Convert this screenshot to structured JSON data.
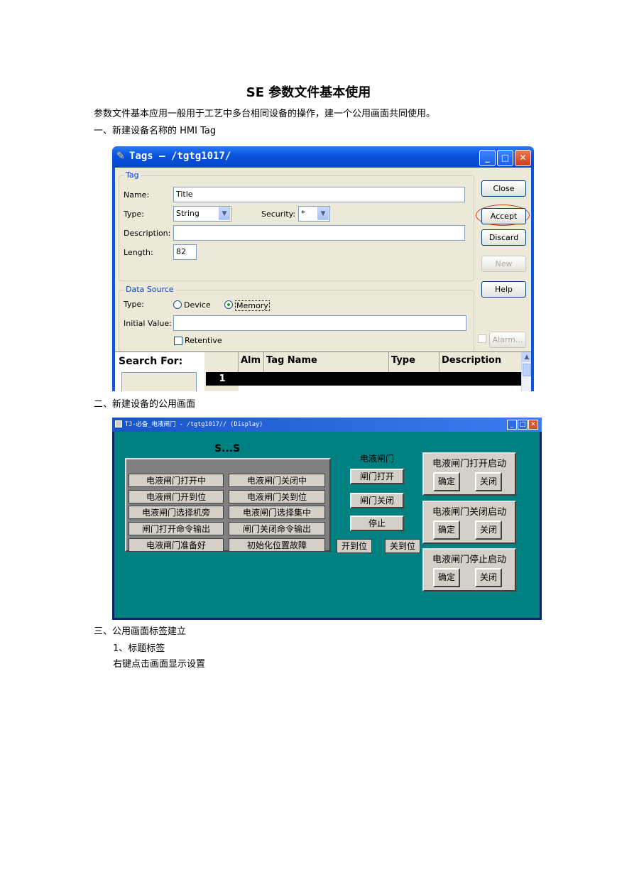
{
  "doc": {
    "title": "SE 参数文件基本使用",
    "intro": "参数文件基本应用一般用于工艺中多台相同设备的操作，建一个公用画面共同使用。",
    "step1": "一、新建设备名称的 HMI Tag",
    "step2": "二、新建设备的公用画面",
    "step3": "三、公用画面标签建立",
    "step3_1": "1、标题标签",
    "step3_2": "右键点击画面显示设置"
  },
  "tags_window": {
    "title": "Tags – /tgtg1017/",
    "group_tag": "Tag",
    "name_label": "Name:",
    "name_value": "Title",
    "type_label": "Type:",
    "type_value": "String",
    "security_label": "Security:",
    "security_value": "*",
    "description_label": "Description:",
    "description_value": "",
    "length_label": "Length:",
    "length_value": "82",
    "group_source": "Data Source",
    "source_type_label": "Type:",
    "radio_device": "Device",
    "radio_memory": "Memory",
    "initial_label": "Initial Value:",
    "initial_value": "",
    "retentive_label": "Retentive",
    "buttons": {
      "close": "Close",
      "accept": "Accept",
      "discard": "Discard",
      "new": "New",
      "help": "Help",
      "alarm": "Alarm..."
    },
    "search_label": "Search For:",
    "grid_headers": [
      "Alm",
      "Tag Name",
      "Type",
      "Description"
    ],
    "row_number": "1"
  },
  "display_window": {
    "title": "TJ-必备_电液闸门 - /tgtg1017// (Display)",
    "header_text": "S...S",
    "status_cells": [
      "电液闸门打开中",
      "电液闸门关闭中",
      "电液闸门开到位",
      "电液闸门关到位",
      "电液闸门选择机旁",
      "电液闸门选择集中",
      "闸门打开命令输出",
      "闸门关闭命令输出",
      "电液闸门准备好",
      "初始化位置故障"
    ],
    "center_label": "电液闸门",
    "btn_open": "闸门打开",
    "btn_close": "闸门关闭",
    "btn_stop": "停止",
    "ind_open": "开到位",
    "ind_closed": "关到位",
    "panels": [
      {
        "title": "电液闸门打开启动",
        "confirm": "确定",
        "close": "关闭"
      },
      {
        "title": "电液闸门关闭启动",
        "confirm": "确定",
        "close": "关闭"
      },
      {
        "title": "电液闸门停止启动",
        "confirm": "确定",
        "close": "关闭"
      }
    ]
  }
}
